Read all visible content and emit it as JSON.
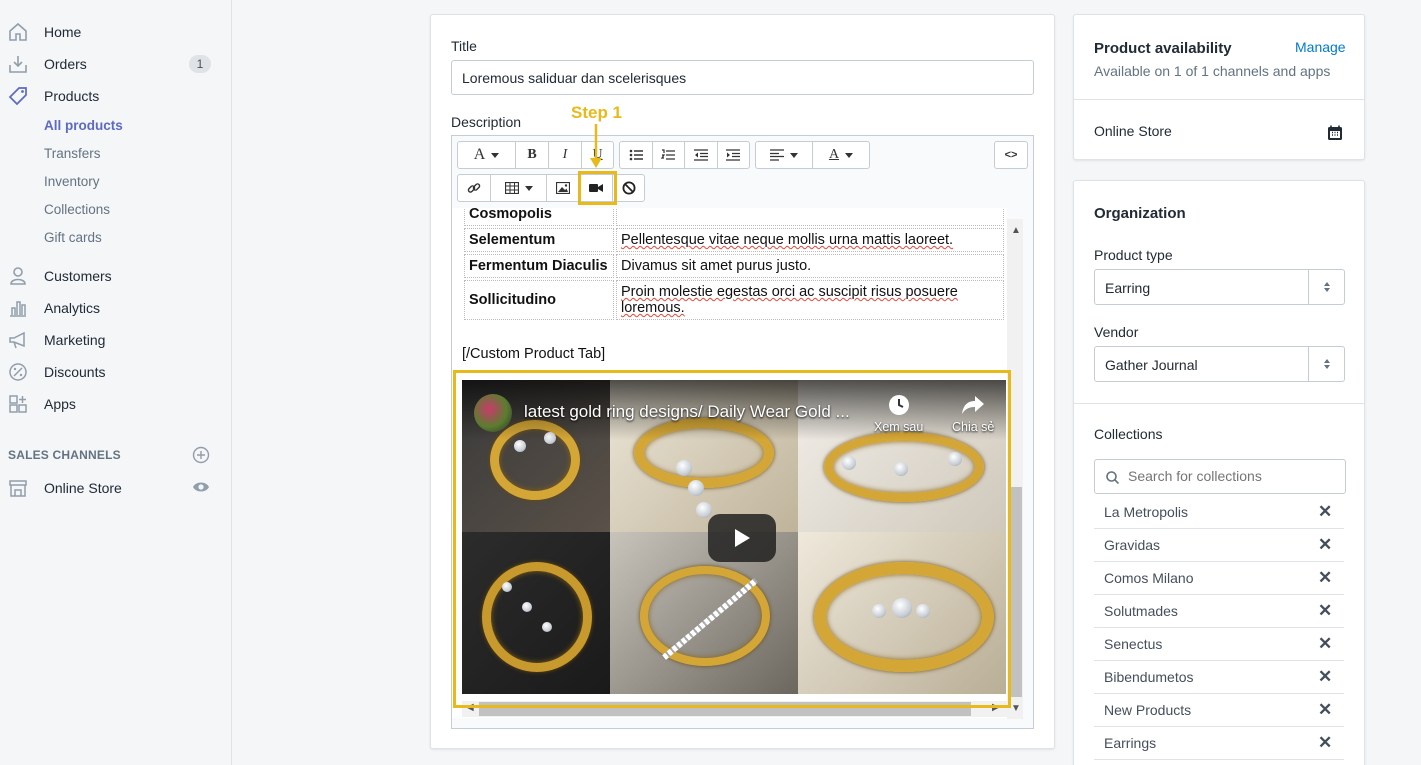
{
  "sidebar": {
    "items": [
      {
        "label": "Home",
        "icon": "home-icon"
      },
      {
        "label": "Orders",
        "icon": "orders-icon",
        "badge": "1"
      },
      {
        "label": "Products",
        "icon": "tag-icon"
      },
      {
        "label": "Customers",
        "icon": "person-icon"
      },
      {
        "label": "Analytics",
        "icon": "bar-chart-icon"
      },
      {
        "label": "Marketing",
        "icon": "megaphone-icon"
      },
      {
        "label": "Discounts",
        "icon": "discount-icon"
      },
      {
        "label": "Apps",
        "icon": "apps-icon"
      }
    ],
    "product_sub": [
      "All products",
      "Transfers",
      "Inventory",
      "Collections",
      "Gift cards"
    ],
    "sales_channels_heading": "SALES CHANNELS",
    "online_store": "Online Store"
  },
  "product": {
    "title_label": "Title",
    "title_value": "Loremous saliduar dan scelerisques",
    "description_label": "Description",
    "step_label": "Step 1",
    "html_toggle": "<>",
    "table_rows": [
      {
        "key": "Cosmopolis",
        "value": ""
      },
      {
        "key": "Selementum",
        "value": "Pellentesque vitae neque mollis urna mattis laoreet."
      },
      {
        "key": "Fermentum Diaculis",
        "value": "Divamus sit amet purus justo."
      },
      {
        "key": "Sollicitudino",
        "value": "Proin molestie egestas orci ac suscipit risus posuere loremous."
      }
    ],
    "custom_tab_close": "[/Custom Product Tab]",
    "video": {
      "title": "latest gold ring designs/ Daily Wear Gold ...",
      "watch_later": "Xem sau",
      "share": "Chia sẻ"
    }
  },
  "availability": {
    "heading": "Product availability",
    "manage": "Manage",
    "sub": "Available on 1 of 1 channels and apps",
    "channel": "Online Store"
  },
  "organization": {
    "heading": "Organization",
    "product_type_label": "Product type",
    "product_type_value": "Earring",
    "vendor_label": "Vendor",
    "vendor_value": "Gather Journal",
    "collections_label": "Collections",
    "search_placeholder": "Search for collections",
    "collections": [
      "La Metropolis",
      "Gravidas",
      "Comos Milano",
      "Solutmades",
      "Senectus",
      "Bibendumetos",
      "New Products",
      "Earrings"
    ]
  },
  "colors": {
    "accent": "#5c6ac4",
    "highlight": "#e8b91a",
    "gold": "#d4a636"
  }
}
